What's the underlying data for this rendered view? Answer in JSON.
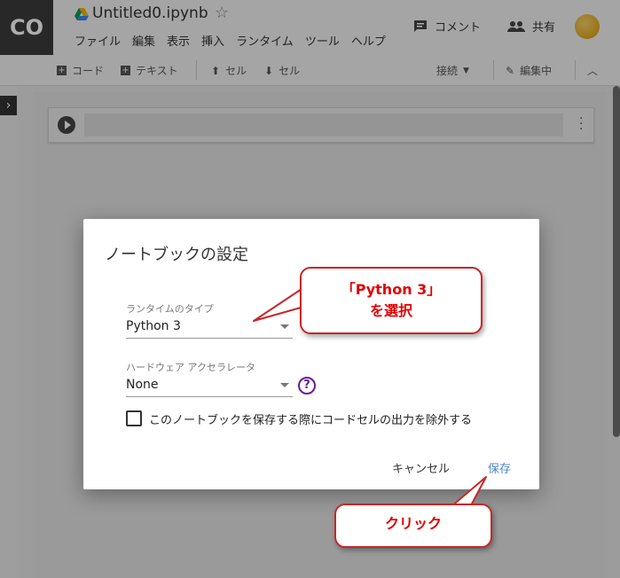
{
  "header": {
    "logo": "CO",
    "notebook_title": "Untitled0.ipynb",
    "menu": [
      "ファイル",
      "編集",
      "表示",
      "挿入",
      "ランタイム",
      "ツール",
      "ヘルプ"
    ],
    "comment_label": "コメント",
    "share_label": "共有"
  },
  "toolbar": {
    "add_code": "コード",
    "add_text": "テキスト",
    "cell_up": "セル",
    "cell_down": "セル",
    "connect": "接続",
    "editing": "編集中"
  },
  "dialog": {
    "title": "ノートブックの設定",
    "runtime_label": "ランタイムのタイプ",
    "runtime_value": "Python 3",
    "accel_label": "ハードウェア アクセラレータ",
    "accel_value": "None",
    "help_glyph": "?",
    "checkbox_label": "このノートブックを保存する際にコードセルの出力を除外する",
    "checkbox_checked": false,
    "cancel": "キャンセル",
    "save": "保存"
  },
  "callouts": {
    "select_line1": "「Python 3」",
    "select_line2": "を選択",
    "click": "クリック"
  },
  "colors": {
    "callout_text": "#e00000",
    "save_link": "#4a86c8",
    "help_icon": "#6a1b9a"
  }
}
